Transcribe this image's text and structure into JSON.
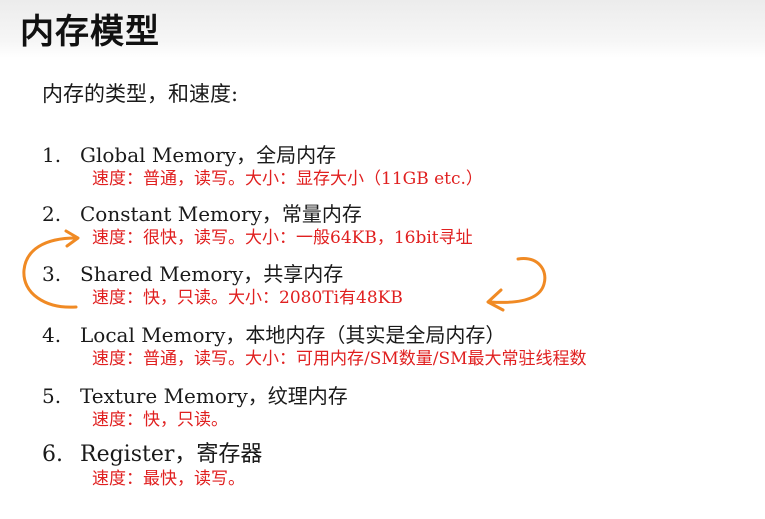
{
  "slide": {
    "title": "内存模型",
    "subtitle": "内存的类型，和速度:",
    "items": [
      {
        "number": "1.",
        "name": "Global Memory，全局内存",
        "desc": "速度：普通，读写。大小：显存大小（11GB etc.）"
      },
      {
        "number": "2.",
        "name": "Constant Memory，常量内存",
        "desc": "速度：很快，读写。大小：一般64KB，16bit寻址"
      },
      {
        "number": "3.",
        "name": "Shared Memory，共享内存",
        "desc": "速度：快，只读。大小：2080Ti有48KB"
      },
      {
        "number": "4.",
        "name": "Local Memory，本地内存（其实是全局内存）",
        "desc": "速度：普通，读写。大小：可用内存/SM数量/SM最大常驻线程数"
      },
      {
        "number": "5.",
        "name": "Texture Memory，纹理内存",
        "desc": "速度：快，只读。"
      },
      {
        "number": "6.",
        "name": "Register，寄存器",
        "desc": "速度：最快，读写。"
      }
    ]
  },
  "colors": {
    "description_text": "#e02020",
    "annotation_stroke": "#f08a24",
    "body_text": "#1a1a1a"
  }
}
